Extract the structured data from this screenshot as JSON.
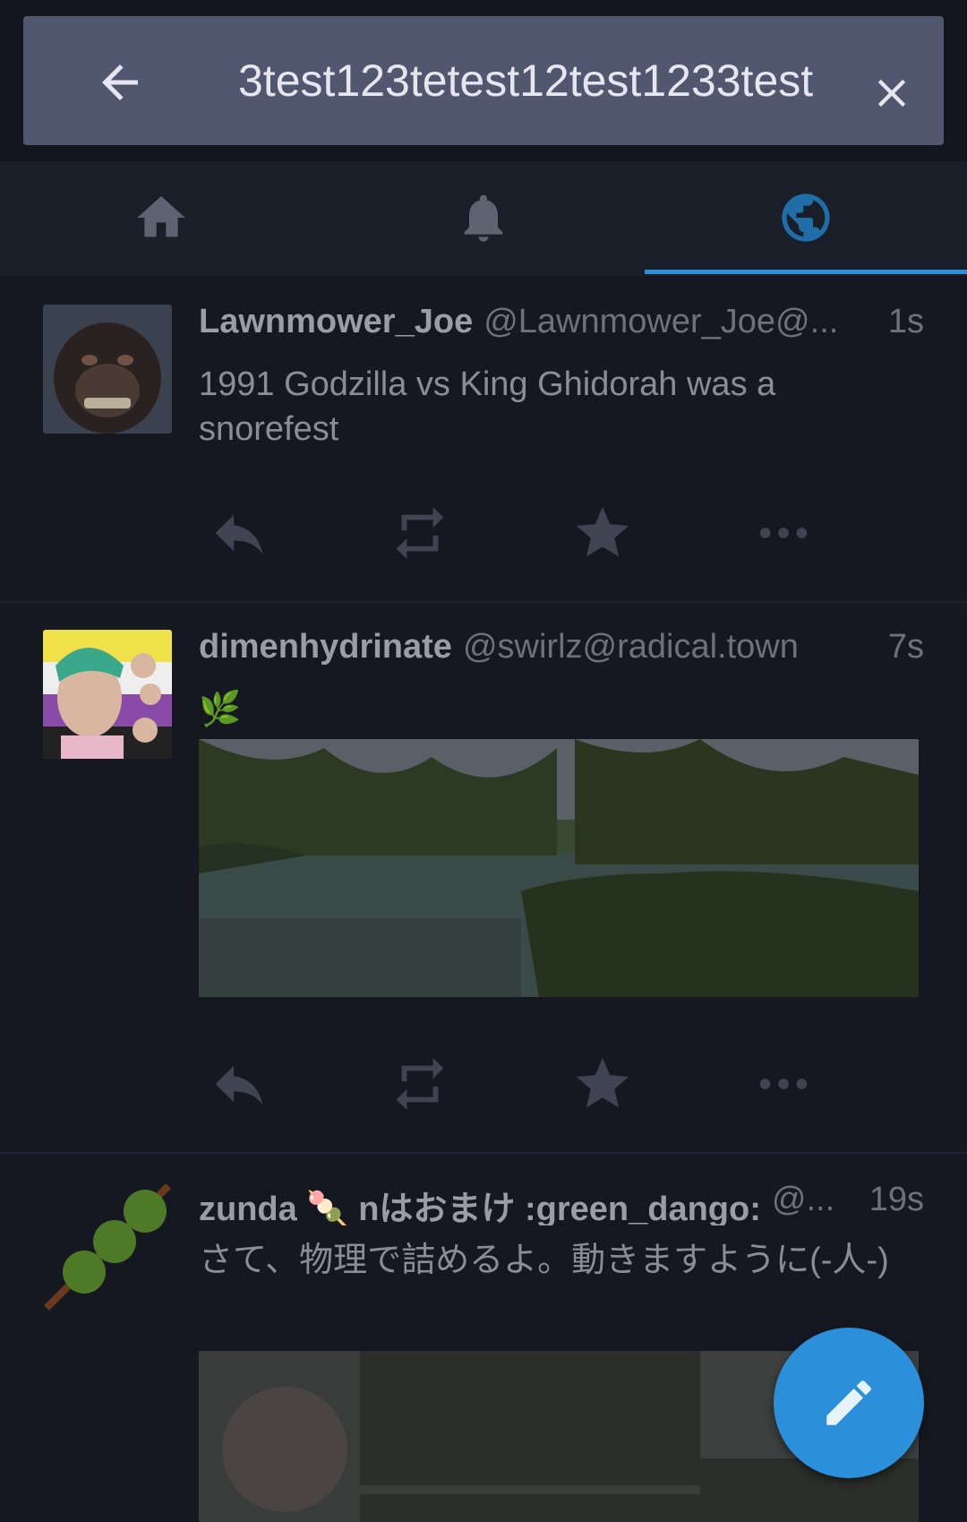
{
  "search": {
    "query": "3test123tetest12test1233test",
    "back_icon": "arrow-left-icon",
    "clear_icon": "close-icon"
  },
  "tabs": [
    {
      "name": "home",
      "icon": "home-icon",
      "active": false
    },
    {
      "name": "notifications",
      "icon": "bell-icon",
      "active": false
    },
    {
      "name": "federated",
      "icon": "globe-icon",
      "active": true
    }
  ],
  "colors": {
    "accent": "#2b8fd9",
    "background": "#161821",
    "search_bg": "#525770"
  },
  "statuses": [
    {
      "display_name": "Lawnmower_Joe",
      "acct": "@Lawnmower_Joe@...",
      "time": "1s",
      "content": "1991 Godzilla vs King Ghidorah was a snorefest"
    },
    {
      "display_name": "dimenhydrinate",
      "acct": "@swirlz@radical.town",
      "time": "7s",
      "content": "🌿"
    },
    {
      "display_name": "zunda 🍡 nはおまけ :green_dango:",
      "acct": "@...",
      "time": "19s",
      "content": "さて、物理で詰めるよ。動きますように(-人-)"
    }
  ],
  "actions": [
    "reply-icon",
    "boost-icon",
    "favourite-icon",
    "more-icon"
  ],
  "fab": {
    "icon": "pencil-icon"
  }
}
